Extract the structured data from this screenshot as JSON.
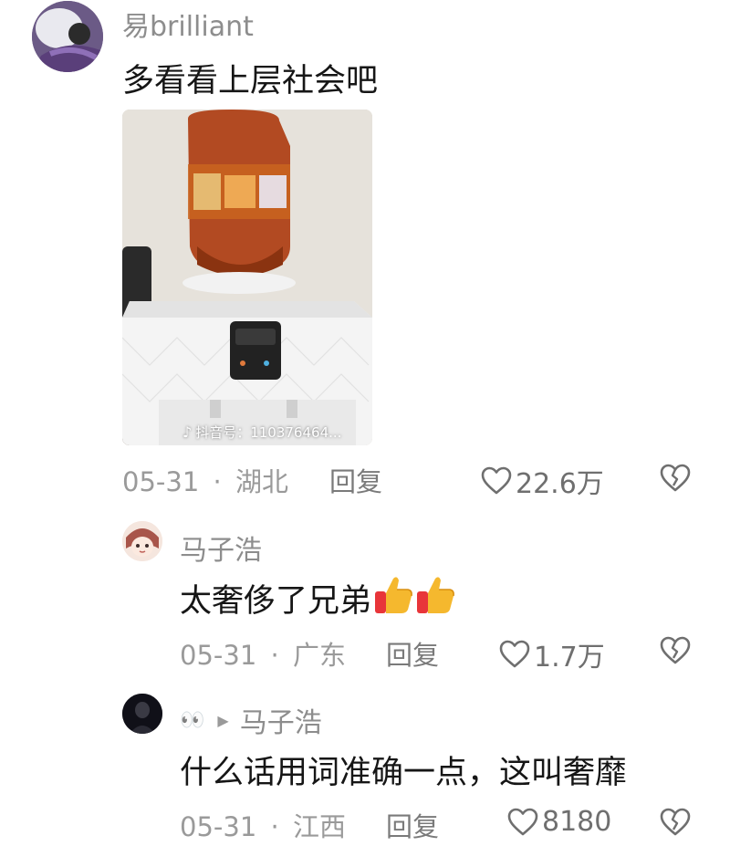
{
  "comments": [
    {
      "username": "易brilliant",
      "text": "多看看上层社会吧",
      "date": "05-31",
      "location": "湖北",
      "reply_label": "回复",
      "likes": "22.6万",
      "photo": {
        "watermark": "抖音号：110376464..."
      }
    },
    {
      "username": "马子浩",
      "text": "太奢侈了兄弟",
      "emojis": [
        "thumbs-up",
        "thumbs-up"
      ],
      "date": "05-31",
      "location": "广东",
      "reply_label": "回复",
      "likes": "1.7万"
    },
    {
      "username_prefix": "👀",
      "reply_to": "马子浩",
      "text": "什么话用词准确一点，这叫奢靡",
      "date": "05-31",
      "location": "江西",
      "reply_label": "回复",
      "likes": "8180"
    }
  ],
  "separator": "·",
  "colors": {
    "text": "#161616",
    "muted": "#9a9a9a",
    "username": "#8d8d8d"
  }
}
